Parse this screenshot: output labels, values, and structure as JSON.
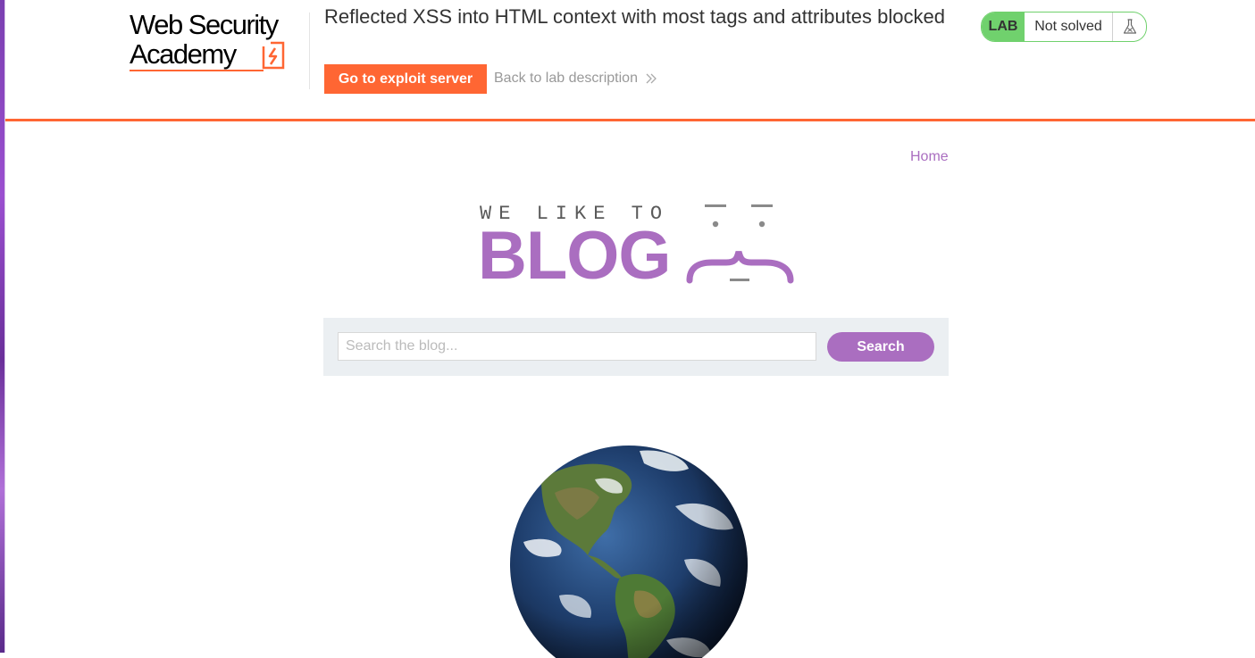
{
  "header": {
    "logo_line1": "Web Security",
    "logo_line2": "Academy",
    "lab_title": "Reflected XSS into HTML context with most tags and attributes blocked",
    "exploit_button": "Go to exploit server",
    "back_link": "Back to lab description",
    "lab_badge": "LAB",
    "lab_status": "Not solved",
    "icons": [
      "web-security-academy-logo-mark",
      "chevron-double-right-icon",
      "flask-icon"
    ]
  },
  "nav": {
    "home": "Home"
  },
  "banner": {
    "tagline": "WE LIKE TO",
    "title": "BLOG",
    "graphic": "emoticon-face-icon"
  },
  "search": {
    "placeholder": "Search the blog...",
    "value": "",
    "button": "Search"
  },
  "post": {
    "image": "globe-earth-image"
  },
  "colors": {
    "brand_orange": "#ff6633",
    "blog_purple": "#aa6ec0",
    "lab_green": "#70d16d",
    "search_panel_bg": "#ebeff2"
  }
}
